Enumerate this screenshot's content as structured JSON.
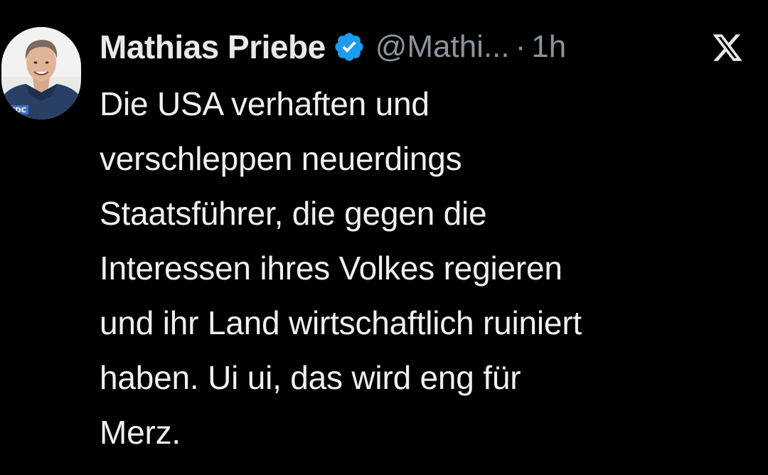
{
  "tweet": {
    "author": {
      "display_name": "Mathias Priebe",
      "handle": "@Mathi...",
      "avatar_icon": "profile-photo",
      "verified_icon": "verified-badge-icon",
      "avatar_shirt_text": "NDC"
    },
    "separator": "·",
    "timestamp": "1h",
    "platform_icon": "x-logo-icon",
    "text_lines": [
      "Die USA verhaften und",
      "verschleppen neuerdings",
      "Staatsführer, die gegen die",
      "Interessen ihres Volkes regieren",
      "und ihr Land wirtschaftlich ruiniert",
      "haben. Ui ui, das wird eng für",
      "Merz."
    ]
  },
  "colors": {
    "background": "#000000",
    "text_primary": "#e7e9ea",
    "text_secondary": "#8b949b",
    "verified_blue": "#1d9bf0"
  }
}
